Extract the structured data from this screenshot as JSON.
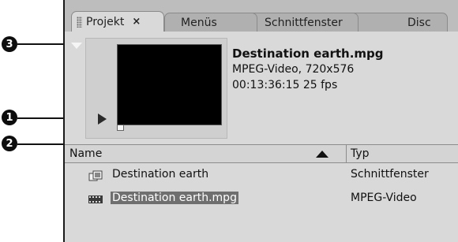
{
  "callouts": {
    "one": "1",
    "two": "2",
    "three": "3"
  },
  "tabs": [
    {
      "label": "Projekt",
      "close": "×"
    },
    {
      "label": "Menüs"
    },
    {
      "label": "Schnittfenster"
    },
    {
      "label": "Disc"
    }
  ],
  "preview": {
    "file_name": "Destination earth.mpg",
    "format": "MPEG-Video, 720x576",
    "duration": "00:13:36:15 25 fps"
  },
  "columns": {
    "name": "Name",
    "type": "Typ"
  },
  "items": [
    {
      "name": "Destination earth",
      "type": "Schnittfenster",
      "icon": "sequence-icon"
    },
    {
      "name": "Destination earth.mpg",
      "type": "MPEG-Video",
      "icon": "film-icon",
      "selected": true
    }
  ]
}
